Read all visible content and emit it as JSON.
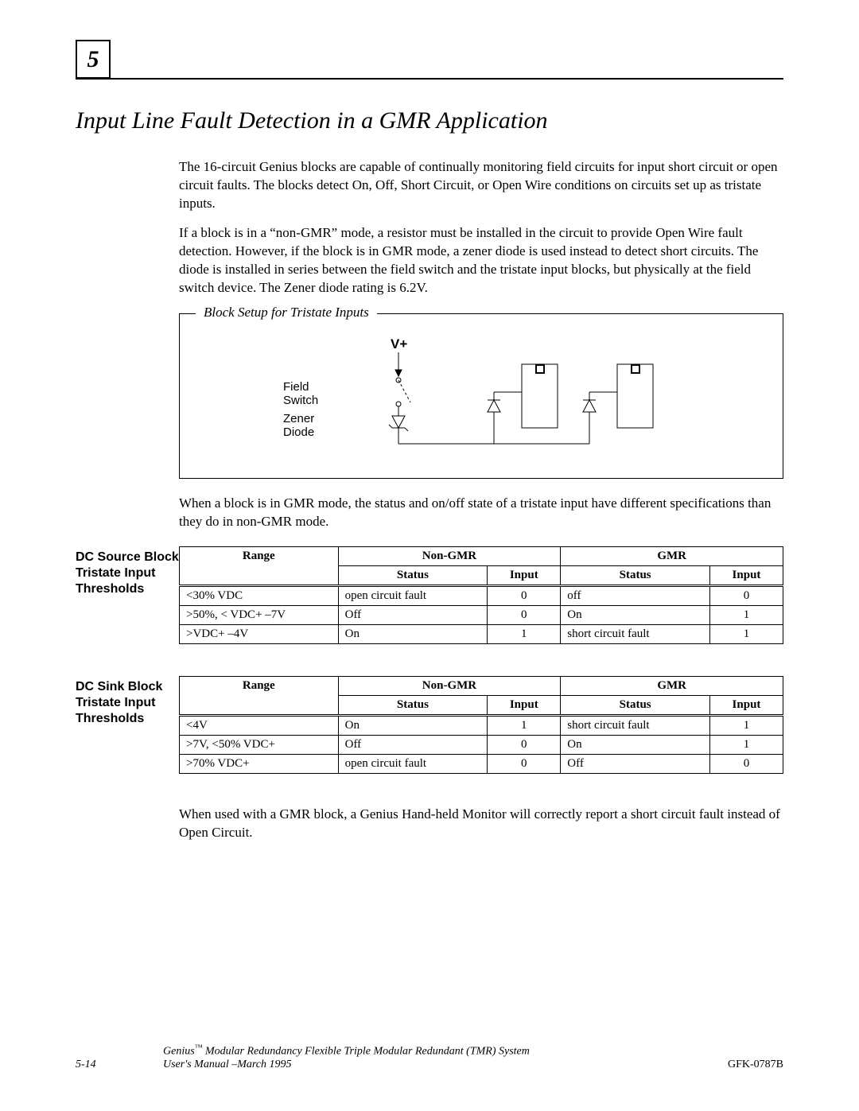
{
  "chapter_number": "5",
  "section_title": "Input Line Fault Detection in a GMR Application",
  "paragraphs": {
    "p1": "The 16-circuit Genius blocks are capable of continually monitoring field circuits for input short circuit or open circuit faults.  The blocks detect On, Off, Short Circuit, or Open Wire conditions on circuits set up as tristate inputs.",
    "p2": "If a block is in a “non-GMR” mode, a resistor must be installed in the circuit to provide Open Wire fault detection. However, if the block is in GMR mode, a zener diode is used instead to detect short circuits.  The diode is installed in series between the field switch and the tristate input blocks, but physically at the field switch device. The Zener diode rating is 6.2V.",
    "p3": "When a block is in GMR mode, the status and on/off state of a tristate input have different specifications than they do in non-GMR mode.",
    "p4": "When used with a GMR block, a Genius Hand-held Monitor will correctly report a short circuit fault instead of Open Circuit."
  },
  "diagram": {
    "caption": "Block Setup for Tristate Inputs",
    "vplus": "V+",
    "field_switch": "Field\nSwitch",
    "zener_diode": "Zener\nDiode"
  },
  "table1": {
    "label": "DC Source Block Tristate Input Thresholds",
    "headers": {
      "range": "Range",
      "nongmr": "Non-GMR",
      "gmr": "GMR",
      "status": "Status",
      "input": "Input"
    },
    "rows": [
      {
        "range": "<30%  VDC",
        "ng_status": "open circuit fault",
        "ng_input": "0",
        "g_status": "off",
        "g_input": "0"
      },
      {
        "range": ">50%, < VDC+ –7V",
        "ng_status": "Off",
        "ng_input": "0",
        "g_status": "On",
        "g_input": "1"
      },
      {
        "range": ">VDC+   –4V",
        "ng_status": "On",
        "ng_input": "1",
        "g_status": "short circuit fault",
        "g_input": "1"
      }
    ]
  },
  "table2": {
    "label": "DC Sink Block Tristate Input Thresholds",
    "headers": {
      "range": "Range",
      "nongmr": "Non-GMR",
      "gmr": "GMR",
      "status": "Status",
      "input": "Input"
    },
    "rows": [
      {
        "range": "<4V",
        "ng_status": "On",
        "ng_input": "1",
        "g_status": "short circuit fault",
        "g_input": "1"
      },
      {
        "range": ">7V,  <50% VDC+",
        "ng_status": "Off",
        "ng_input": "0",
        "g_status": "On",
        "g_input": "1"
      },
      {
        "range": ">70%   VDC+",
        "ng_status": "open circuit fault",
        "ng_input": "0",
        "g_status": "Off",
        "g_input": "0"
      }
    ]
  },
  "footer": {
    "page": "5-14",
    "title_a": "Genius",
    "tm": "™",
    "title_b": " Modular Redundancy Flexible Triple Modular Redundant (TMR) System",
    "title_c": "User's Manual –March 1995",
    "docnum": "GFK-0787B"
  }
}
